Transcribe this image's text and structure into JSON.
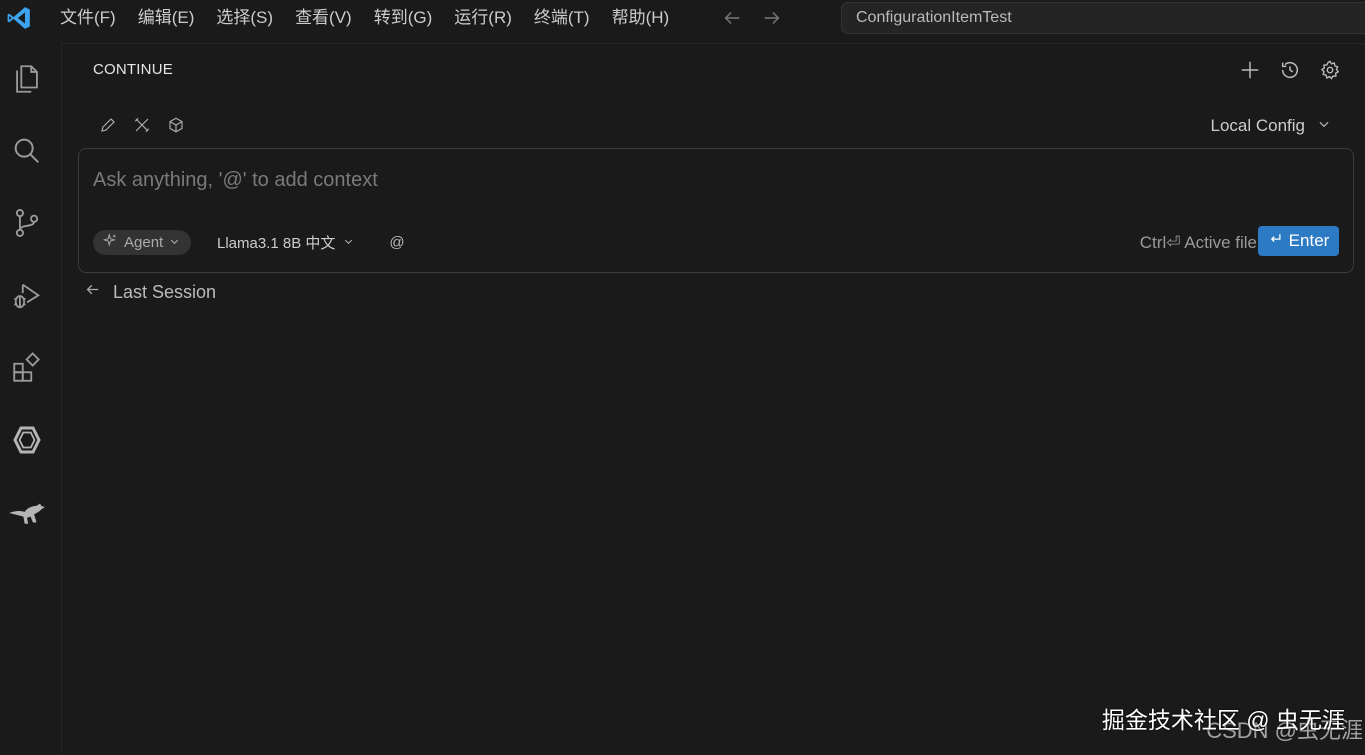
{
  "titlebar": {
    "menus": [
      "文件(F)",
      "编辑(E)",
      "选择(S)",
      "查看(V)",
      "转到(G)",
      "运行(R)",
      "终端(T)",
      "帮助(H)"
    ],
    "search_text": "ConfigurationItemTest"
  },
  "activitybar": {
    "icons": [
      "explorer-icon",
      "search-icon",
      "source-control-icon",
      "run-debug-icon",
      "extensions-icon",
      "continue-icon",
      "kangaroo-icon"
    ]
  },
  "panel": {
    "title": "CONTINUE",
    "config_label": "Local Config"
  },
  "input": {
    "placeholder": "Ask anything, '@' to add context",
    "mode_label": "Agent",
    "model_label": "Llama3.1 8B 中文",
    "at_label": "@",
    "shortcut_hint": "Ctrl⏎ Active file",
    "enter_label": "Enter"
  },
  "history": {
    "last_session_label": "Last Session"
  },
  "watermark": {
    "primary": "掘金技术社区 @ 虫无涯",
    "secondary": "CSDN @虫无涯"
  },
  "colors": {
    "background": "#1a1a1a",
    "accent": "#2c7ac4",
    "vscode_blue": "#3ca4f0"
  }
}
